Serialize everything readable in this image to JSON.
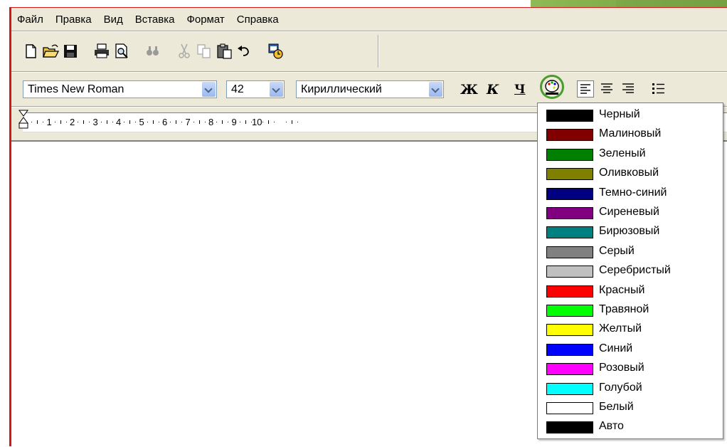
{
  "menubar": {
    "items": [
      "Файл",
      "Правка",
      "Вид",
      "Вставка",
      "Формат",
      "Справка"
    ]
  },
  "toolbar": {
    "icons": [
      "new-document-icon",
      "open-folder-icon",
      "save-icon",
      "print-icon",
      "print-preview-icon",
      "find-icon",
      "cut-icon",
      "copy-icon",
      "paste-icon",
      "undo-icon",
      "insert-datetime-icon"
    ]
  },
  "format_bar": {
    "font_name": "Times New Roman",
    "font_size": "42",
    "script": "Кириллический",
    "bold_label": "Ж",
    "italic_label": "К",
    "underline_label": "Ч"
  },
  "ruler": {
    "numbers": [
      "1",
      "2",
      "3",
      "4",
      "5",
      "6",
      "7",
      "8",
      "9",
      "10"
    ]
  },
  "color_menu": {
    "items": [
      {
        "name": "Черный",
        "color": "#000000"
      },
      {
        "name": "Малиновый",
        "color": "#800000"
      },
      {
        "name": "Зеленый",
        "color": "#008000"
      },
      {
        "name": "Оливковый",
        "color": "#808000"
      },
      {
        "name": "Темно-синий",
        "color": "#000080"
      },
      {
        "name": "Сиреневый",
        "color": "#800080"
      },
      {
        "name": "Бирюзовый",
        "color": "#008080"
      },
      {
        "name": "Серый",
        "color": "#808080"
      },
      {
        "name": "Серебристый",
        "color": "#c0c0c0"
      },
      {
        "name": "Красный",
        "color": "#ff0000"
      },
      {
        "name": "Травяной",
        "color": "#00ff00"
      },
      {
        "name": "Желтый",
        "color": "#ffff00"
      },
      {
        "name": "Синий",
        "color": "#0000ff"
      },
      {
        "name": "Розовый",
        "color": "#ff00ff"
      },
      {
        "name": "Голубой",
        "color": "#00ffff"
      },
      {
        "name": "Белый",
        "color": "#ffffff"
      },
      {
        "name": "Авто",
        "color": "#000000"
      }
    ]
  },
  "colors": {
    "accent_ring": "#4a9c2d",
    "window_border": "#d21919",
    "chrome": "#ece9d8"
  }
}
